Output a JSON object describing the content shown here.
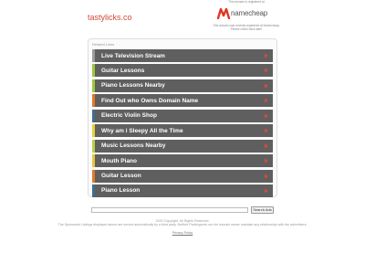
{
  "site": {
    "name": "tastylicks.co"
  },
  "brand": {
    "notice": "This domain is registered at",
    "logo_text": "namecheap",
    "logo_icon": "namecheap-logo-icon",
    "description": "This domain was recently registered at Namecheap. Please check back later!",
    "accent_color": "#de3723"
  },
  "related": {
    "title": "Related Links",
    "links": [
      {
        "label": "Live Television Stream",
        "stripe": "#9c9c9c"
      },
      {
        "label": "Guitar Lessons",
        "stripe": "#9ac93b"
      },
      {
        "label": "Piano Lessons Nearby",
        "stripe": "#a0c839"
      },
      {
        "label": "Find Out who Owns Domain Name",
        "stripe": "#e07b28"
      },
      {
        "label": "Electric Violin Shop",
        "stripe": "#3d6f8a"
      },
      {
        "label": "Why am i Sleepy All the Time",
        "stripe": "#e7d03a"
      },
      {
        "label": "Music Lessons Nearby",
        "stripe": "#b8d048"
      },
      {
        "label": "Mouth Piano",
        "stripe": "#e4c93c"
      },
      {
        "label": "Guitar Lesson",
        "stripe": "#e07b28"
      },
      {
        "label": "Piano Lesson",
        "stripe": "#3d6f8a"
      }
    ],
    "arrow_color": "#d94a3a",
    "arrow_icon": "chevron-right-icon"
  },
  "search": {
    "placeholder": "",
    "button_label": "Search Ads"
  },
  "footer": {
    "copyright": "2020 Copyright. All Rights Reserved.",
    "disclaimer": "The Sponsored Listings displayed above are served automatically by a third party. Neither Parkingcrew nor the domain owner maintain any relationship with the advertisers.",
    "privacy_label": "Privacy Policy"
  }
}
